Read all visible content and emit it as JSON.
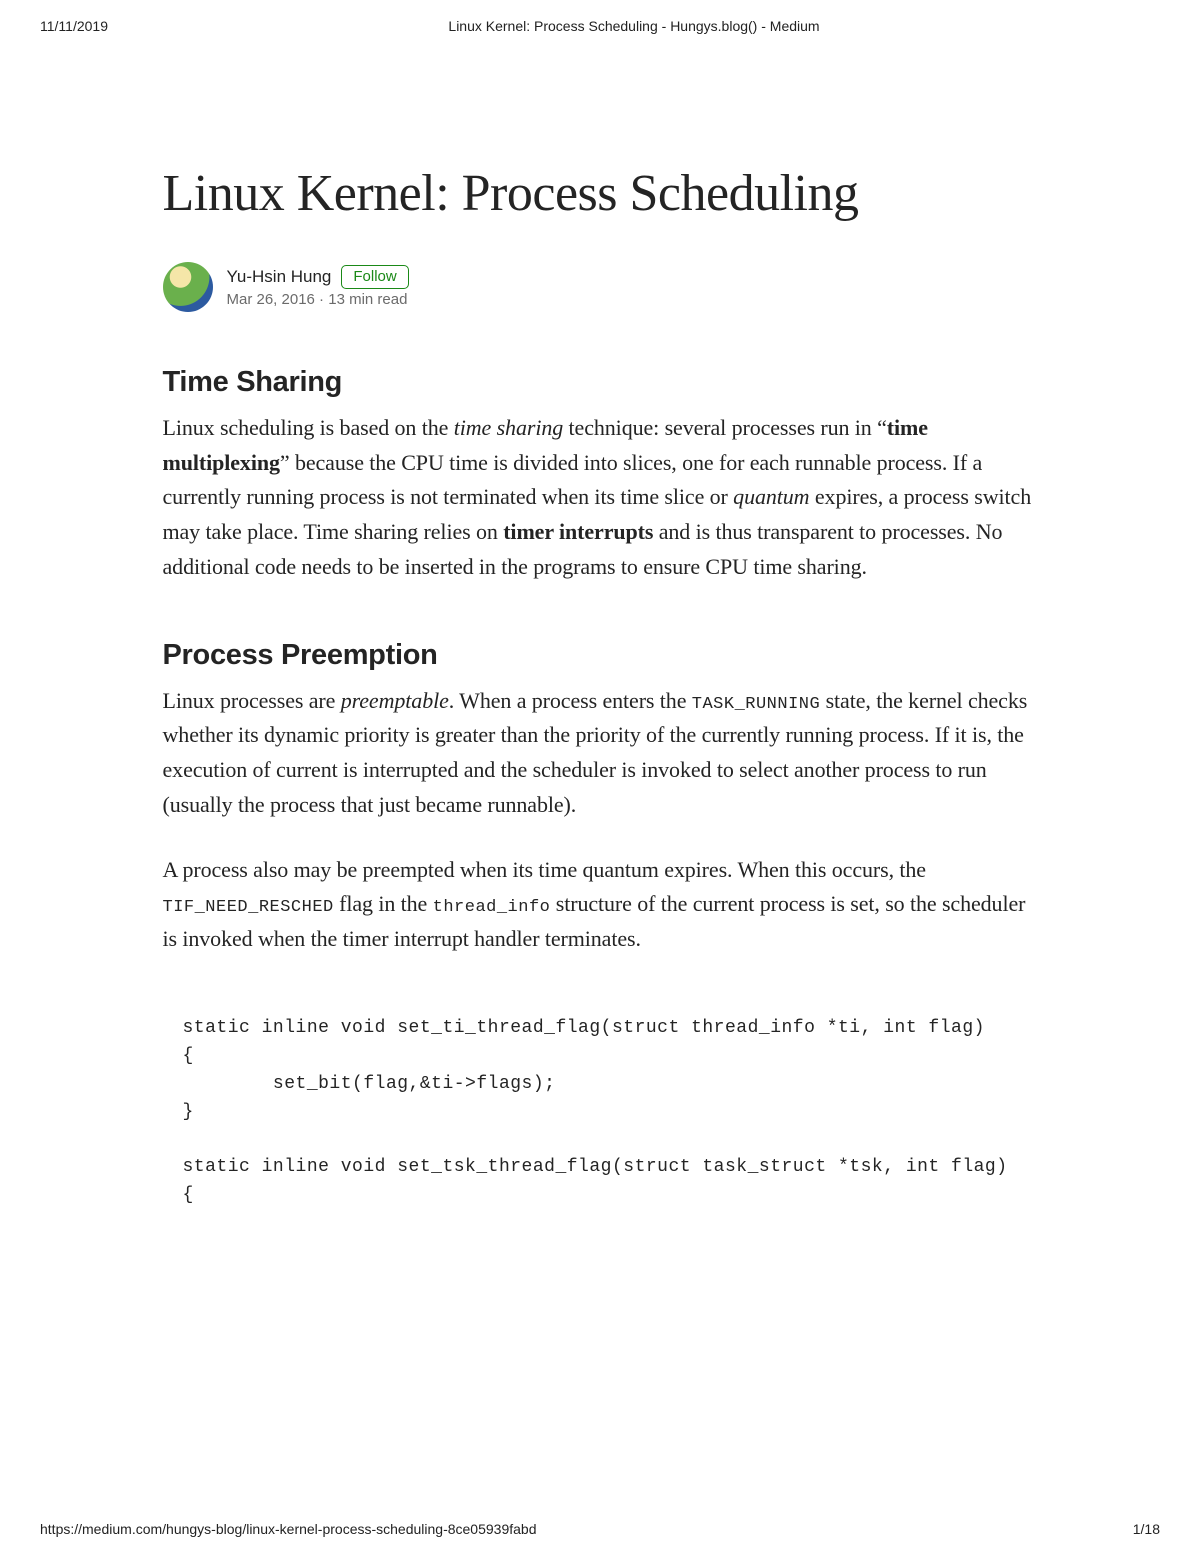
{
  "print": {
    "date": "11/11/2019",
    "header_title": "Linux Kernel: Process Scheduling - Hungys.blog() - Medium",
    "footer_url": "https://medium.com/hungys-blog/linux-kernel-process-scheduling-8ce05939fabd",
    "page_num": "1/18"
  },
  "article": {
    "title": "Linux Kernel: Process Scheduling",
    "author": "Yu-Hsin Hung",
    "follow_label": "Follow",
    "date": "Mar 26, 2016",
    "read_time": "13 min read",
    "meta_sep": " · ",
    "sections": {
      "time_sharing": {
        "heading": "Time Sharing",
        "p1_pre": "Linux scheduling is based on the ",
        "p1_em1": "time sharing",
        "p1_mid1": " technique: several processes run in “",
        "p1_bold1": "time multiplexing",
        "p1_mid2": "” because the CPU time is divided into slices, one for each runnable process. If a currently running process is not terminated when its time slice or ",
        "p1_em2": "quantum",
        "p1_mid3": " expires, a process switch may take place. Time sharing relies on ",
        "p1_bold2": "timer interrupts",
        "p1_post": " and is thus transparent to processes. No additional code needs to be inserted in the programs to ensure CPU time sharing."
      },
      "process_preemption": {
        "heading": "Process Preemption",
        "p1_pre": "Linux processes are ",
        "p1_em1": "preemptable",
        "p1_mid1": ". When a process enters the ",
        "p1_code1": "TASK_RUNNING",
        "p1_post": " state, the kernel checks whether its dynamic priority is greater than the priority of the currently running process. If it is, the execution of current is interrupted and the scheduler is invoked to select another process to run (usually the process that just became runnable).",
        "p2_pre": "A process also may be preempted when its time quantum expires. When this occurs, the ",
        "p2_code1": "TIF_NEED_RESCHED",
        "p2_mid1": " flag in the ",
        "p2_code2": "thread_info",
        "p2_post": " structure of the current process is set, so the scheduler is invoked when the timer interrupt handler terminates."
      }
    },
    "code": "static inline void set_ti_thread_flag(struct thread_info *ti, int flag)\n{\n        set_bit(flag,&ti->flags);\n}\n\nstatic inline void set_tsk_thread_flag(struct task_struct *tsk, int flag)\n{"
  }
}
